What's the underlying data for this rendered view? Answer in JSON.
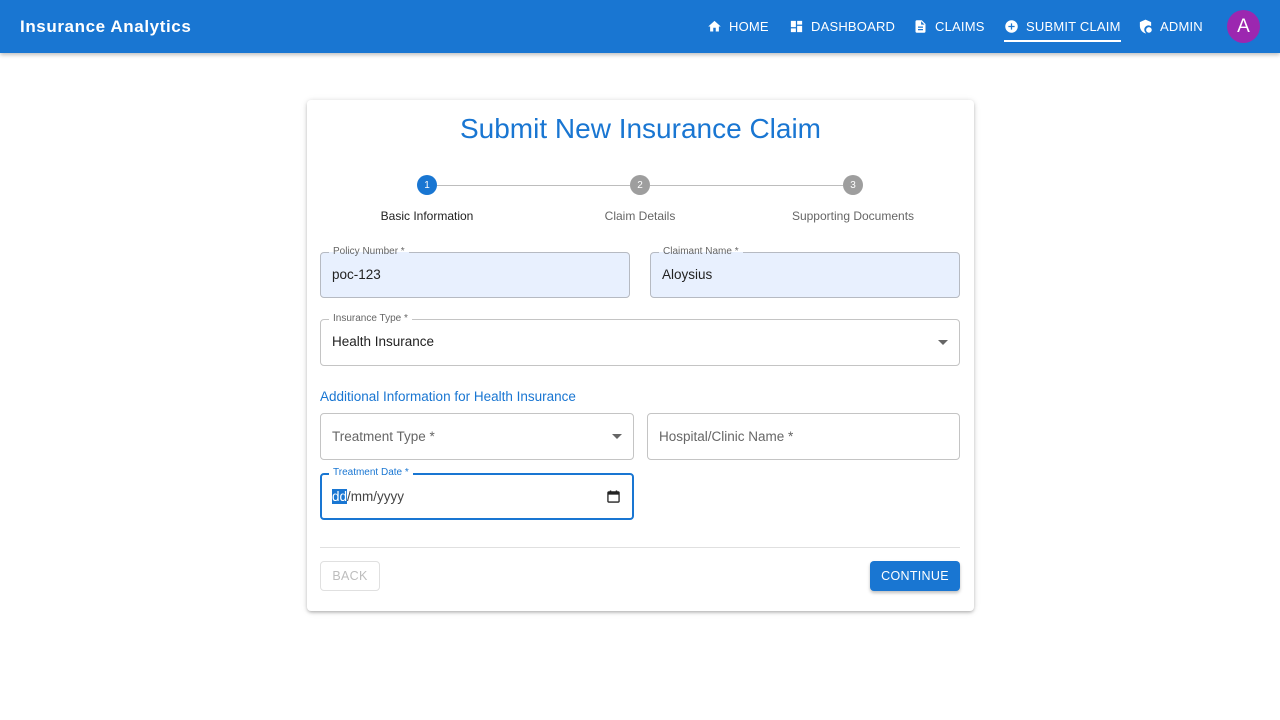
{
  "header": {
    "brand": "Insurance Analytics",
    "nav": [
      {
        "label": "HOME",
        "icon": "home-icon"
      },
      {
        "label": "DASHBOARD",
        "icon": "dashboard-icon"
      },
      {
        "label": "CLAIMS",
        "icon": "document-icon"
      },
      {
        "label": "SUBMIT CLAIM",
        "icon": "add-circle-icon",
        "active": true
      },
      {
        "label": "ADMIN",
        "icon": "admin-shield-icon"
      }
    ],
    "avatar_letter": "A"
  },
  "form": {
    "title": "Submit New Insurance Claim",
    "steps": [
      {
        "number": "1",
        "label": "Basic Information",
        "active": true
      },
      {
        "number": "2",
        "label": "Claim Details",
        "active": false
      },
      {
        "number": "3",
        "label": "Supporting Documents",
        "active": false
      }
    ],
    "policy_number": {
      "label": "Policy Number *",
      "value": "poc-123"
    },
    "claimant_name": {
      "label": "Claimant Name *",
      "value": "Aloysius"
    },
    "insurance_type": {
      "label": "Insurance Type *",
      "value": "Health Insurance"
    },
    "section_title": "Additional Information for Health Insurance",
    "treatment_type": {
      "placeholder": "Treatment Type *"
    },
    "hospital_name": {
      "placeholder": "Hospital/Clinic Name *"
    },
    "treatment_date": {
      "label": "Treatment Date *",
      "value_selected": "dd",
      "value_rest": "/mm/yyyy"
    },
    "back_label": "BACK",
    "continue_label": "CONTINUE"
  },
  "colors": {
    "primary": "#1976d2",
    "avatar": "#9c27b0",
    "step_inactive": "#9e9e9e",
    "autofill": "#e8f0fe"
  }
}
